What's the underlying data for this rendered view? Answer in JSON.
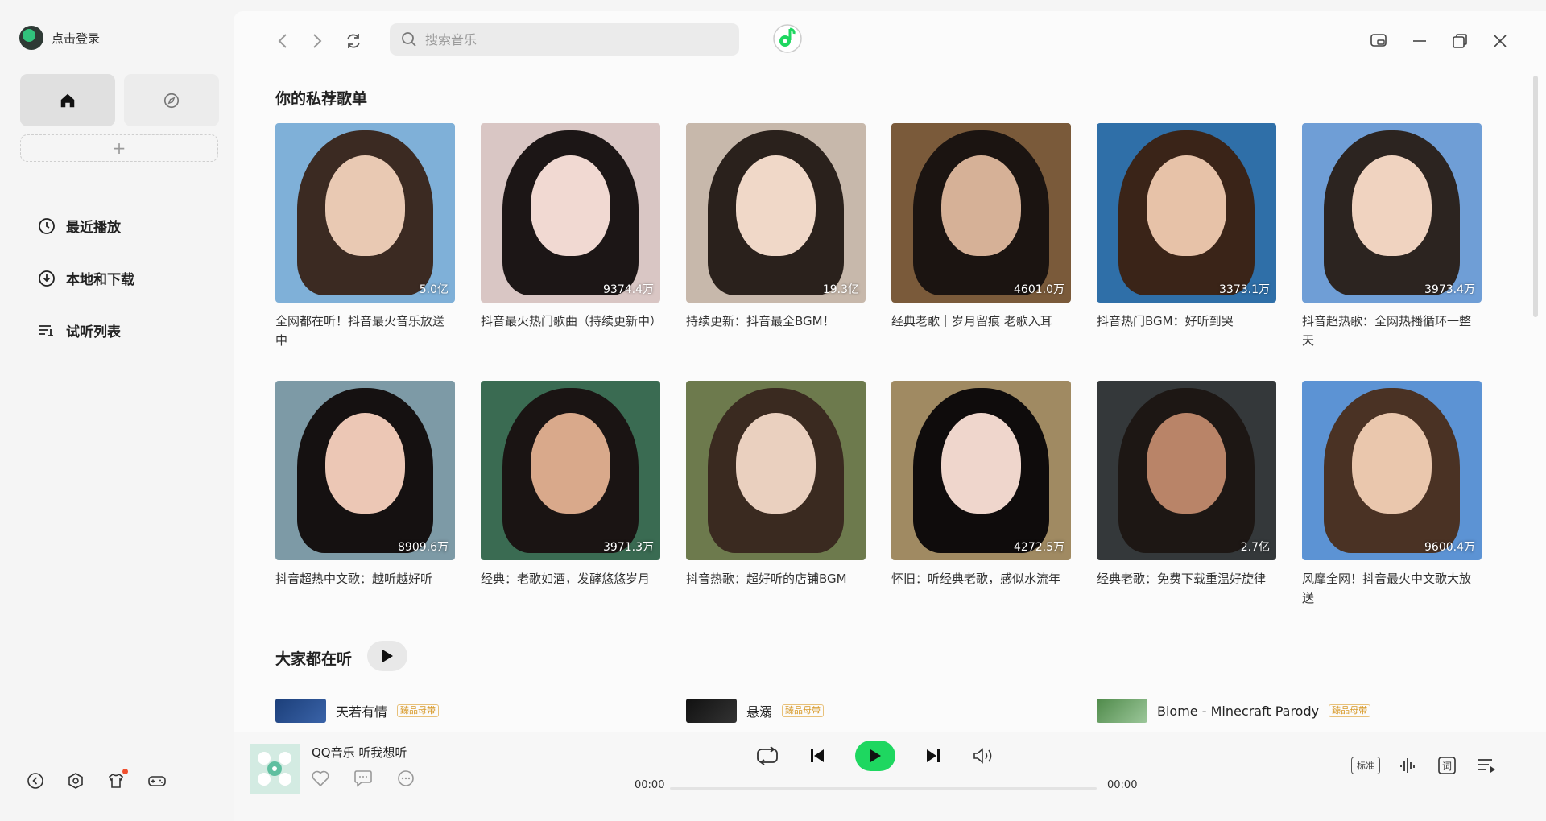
{
  "sidebar": {
    "login_text": "点击登录",
    "menu": [
      {
        "label": "最近播放",
        "icon": "clock-icon"
      },
      {
        "label": "本地和下载",
        "icon": "download-icon"
      },
      {
        "label": "试听列表",
        "icon": "playlist-icon"
      }
    ],
    "add_label": "+"
  },
  "search": {
    "placeholder": "搜索音乐"
  },
  "recommend": {
    "title": "你的私荐歌单",
    "playlists": [
      {
        "count": "5.0亿",
        "title": "全网都在听！抖音最火音乐放送中"
      },
      {
        "count": "9374.4万",
        "title": "抖音最火热门歌曲（持续更新中）"
      },
      {
        "count": "19.3亿",
        "title": "持续更新：抖音最全BGM！"
      },
      {
        "count": "4601.0万",
        "title": "经典老歌｜岁月留痕 老歌入耳"
      },
      {
        "count": "3373.1万",
        "title": "抖音热门BGM：好听到哭"
      },
      {
        "count": "3973.4万",
        "title": "抖音超热歌：全网热播循环一整天"
      },
      {
        "count": "8909.6万",
        "title": "抖音超热中文歌：越听越好听"
      },
      {
        "count": "3971.3万",
        "title": "经典：老歌如酒，发酵悠悠岁月"
      },
      {
        "count": "",
        "title": "抖音热歌：超好听的店铺BGM"
      },
      {
        "count": "4272.5万",
        "title": "怀旧：听经典老歌，感似水流年"
      },
      {
        "count": "2.7亿",
        "title": "经典老歌：免费下载重温好旋律"
      },
      {
        "count": "9600.4万",
        "title": "风靡全网！抖音最火中文歌大放送"
      }
    ]
  },
  "popular": {
    "title": "大家都在听",
    "songs": [
      {
        "name": "天若有情",
        "badge": "臻品母带"
      },
      {
        "name": "悬溺",
        "badge": "臻品母带"
      },
      {
        "name": "Biome - Minecraft Parody",
        "badge": "臻品母带"
      }
    ]
  },
  "player": {
    "title": "QQ音乐 听我想听",
    "time_current": "00:00",
    "time_total": "00:00",
    "quality": "标准",
    "lyric": "词",
    "progress": 0
  },
  "colors": {
    "accent": "#1ed760",
    "brand_green": "#31c27c"
  }
}
